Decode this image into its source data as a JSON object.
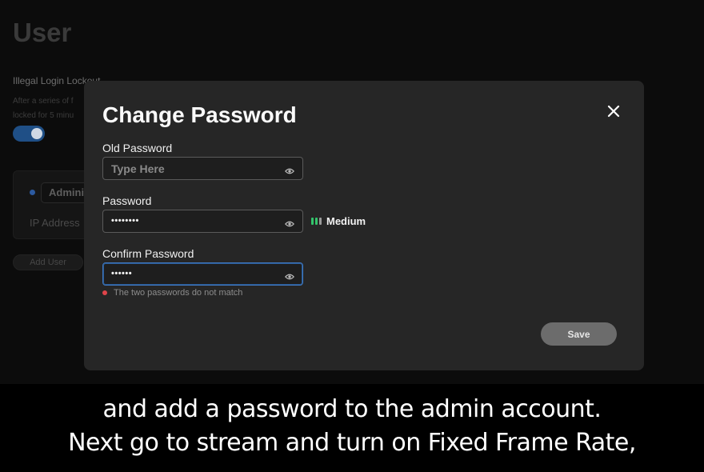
{
  "background": {
    "page_title": "User",
    "lockout_title": "Illegal Login Lockout",
    "lockout_desc_line1": "After a series of f",
    "lockout_desc_line2": "locked for 5 minu",
    "admin_label": "Admini",
    "ip_label": "IP Address",
    "add_user_label": "Add User"
  },
  "modal": {
    "title": "Change Password",
    "old_password": {
      "label": "Old Password",
      "placeholder": "Type Here",
      "value": ""
    },
    "password": {
      "label": "Password",
      "masked_value": "••••••••"
    },
    "confirm_password": {
      "label": "Confirm Password",
      "masked_value": "••••••"
    },
    "strength": {
      "label": "Medium",
      "level": 2,
      "max_level": 3,
      "color_active": "#33c46b",
      "color_inactive": "#9a9a9a"
    },
    "error": {
      "text": "The two passwords do not match",
      "color": "#e0444a"
    },
    "save_label": "Save"
  },
  "captions": {
    "line1": "and add a password to the admin account.",
    "line2": "Next go to stream and turn on Fixed Frame Rate,"
  },
  "icons": {
    "close": "close-icon",
    "eye": "eye-icon",
    "strength": "strength-bars-icon",
    "error": "error-dot-icon"
  }
}
